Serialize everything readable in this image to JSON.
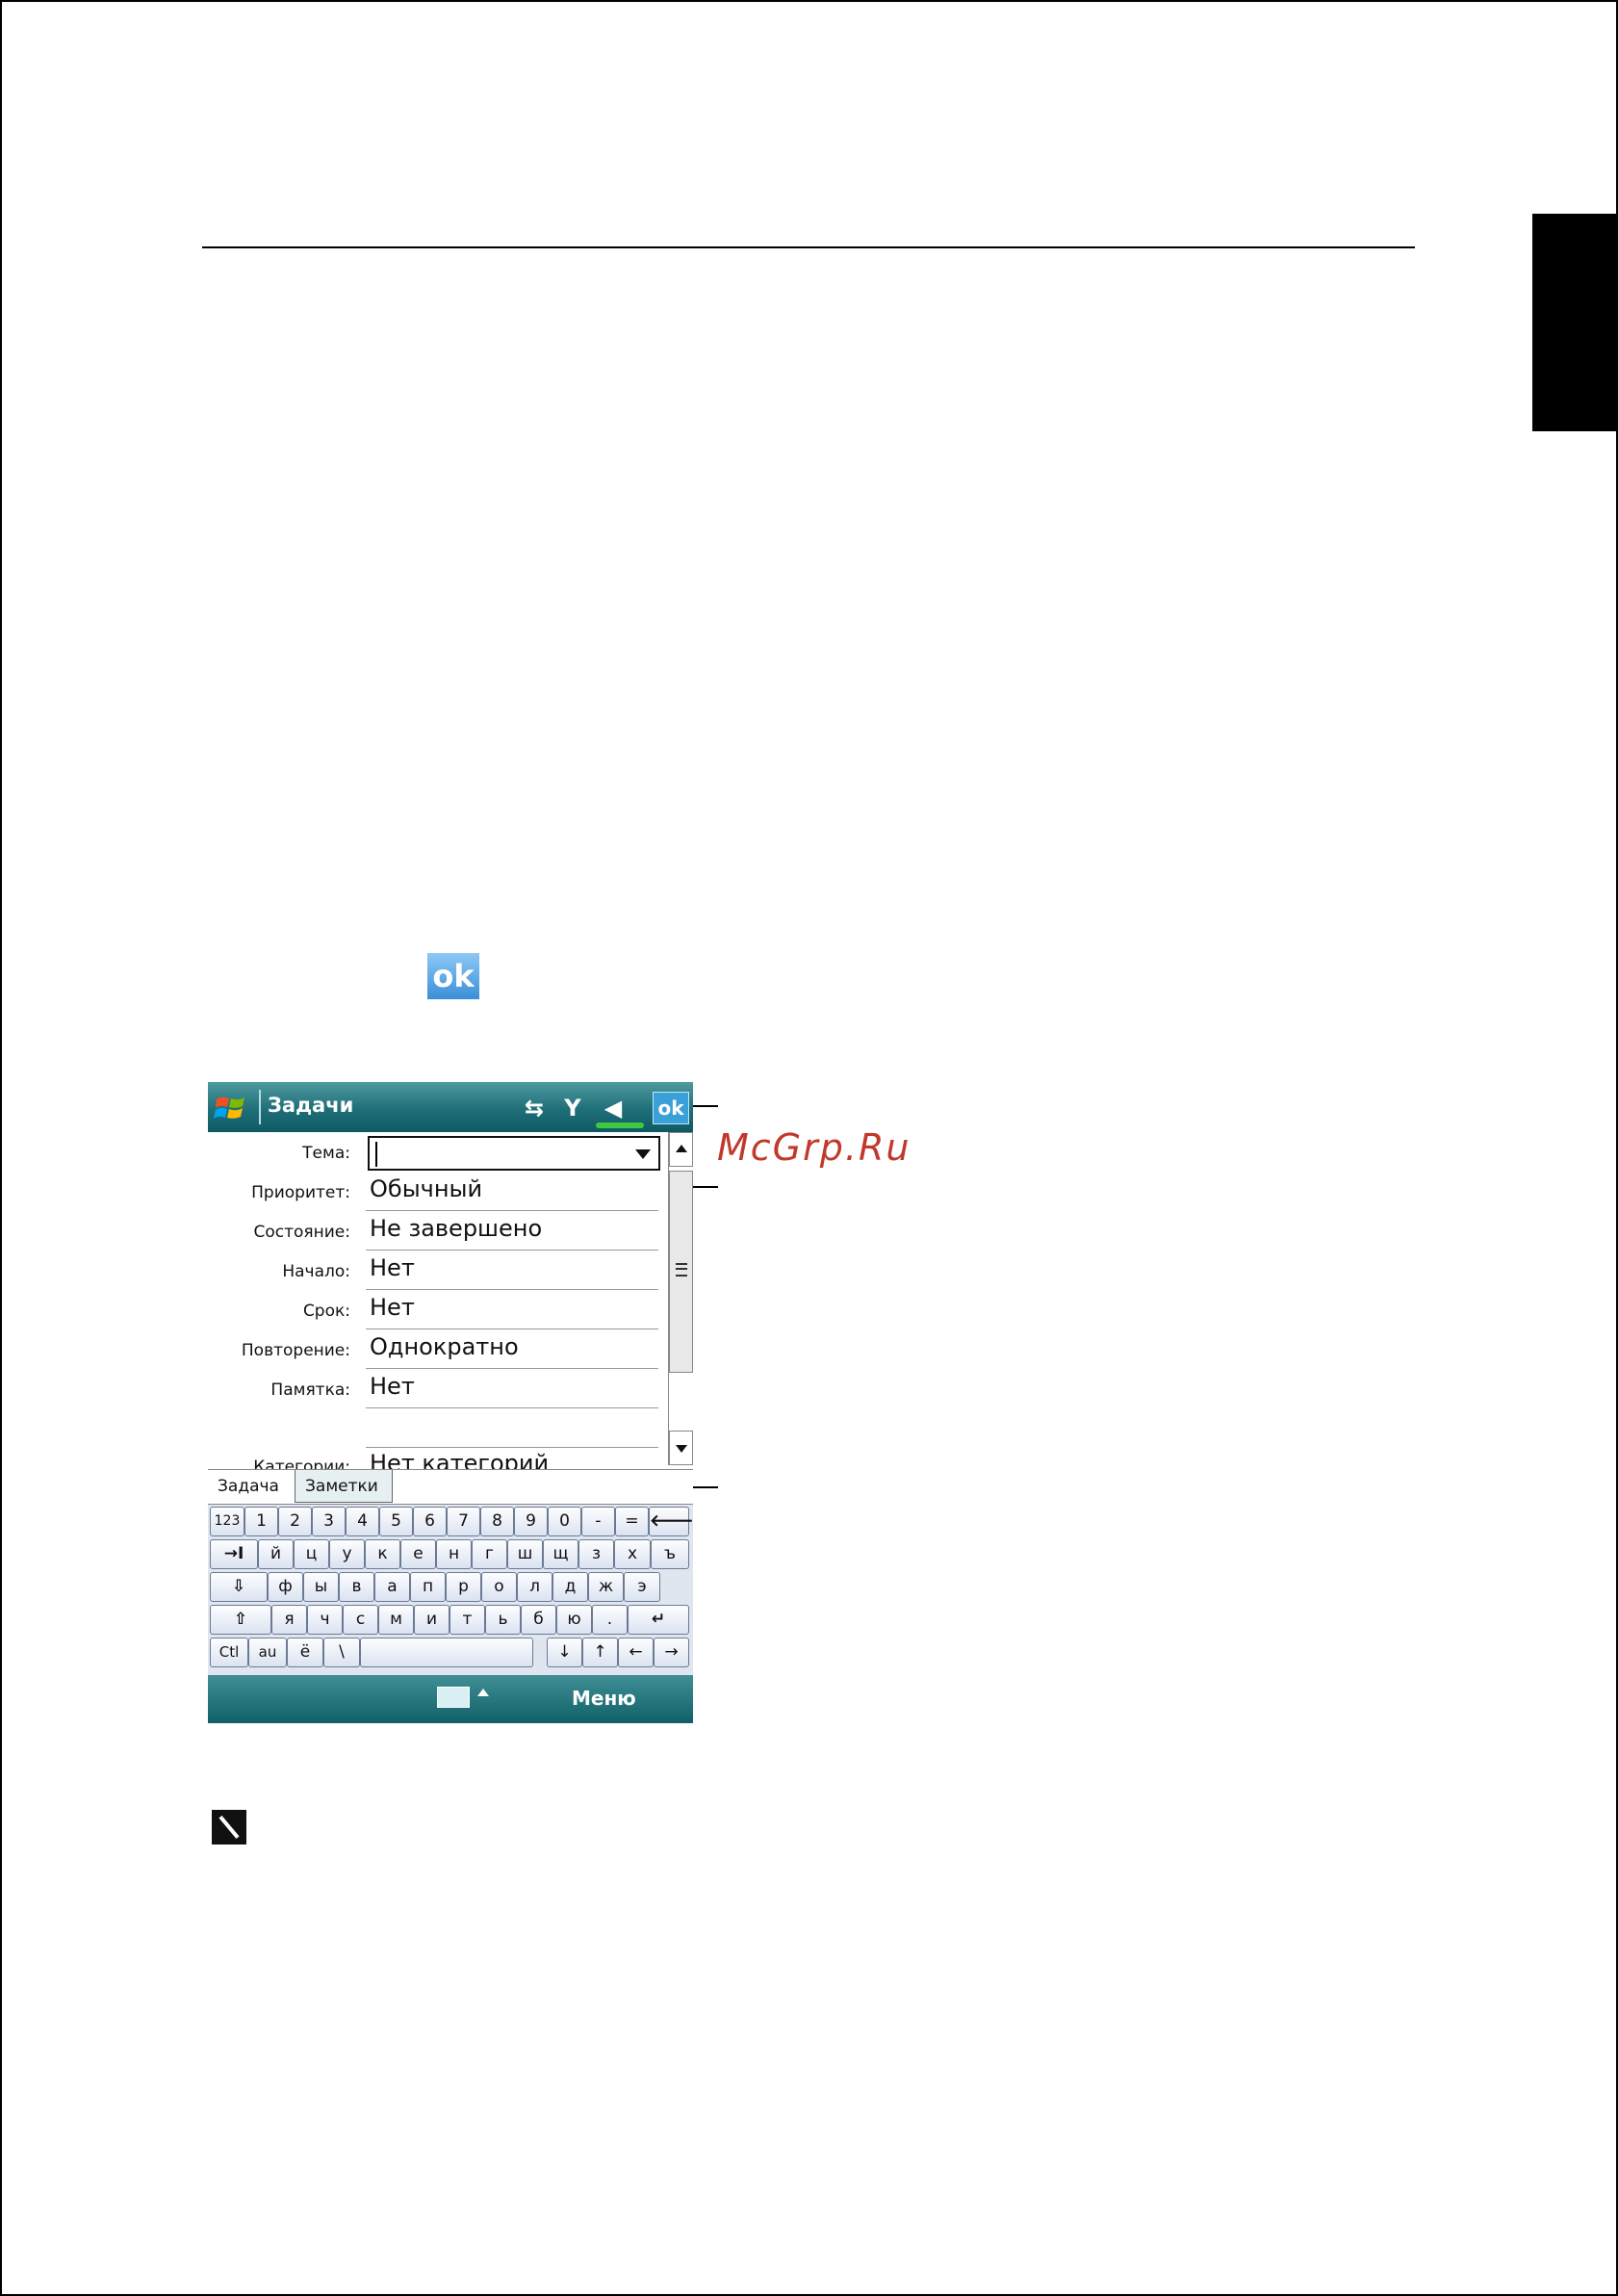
{
  "page": {
    "ok_icon_label": "ok",
    "watermark": "McGrp.Ru"
  },
  "device": {
    "titlebar": {
      "title": "Задачи",
      "ok_label": "ok"
    },
    "form": {
      "fields": [
        {
          "label": "Тема:",
          "value": ""
        },
        {
          "label": "Приоритет:",
          "value": "Обычный"
        },
        {
          "label": "Состояние:",
          "value": "Не завершено"
        },
        {
          "label": "Начало:",
          "value": "Нет"
        },
        {
          "label": "Срок:",
          "value": "Нет"
        },
        {
          "label": "Повторение:",
          "value": "Однократно"
        },
        {
          "label": "Памятка:",
          "value": "Нет"
        },
        {
          "label": "",
          "value": ""
        },
        {
          "label": "Категории:",
          "value": "Нет категорий"
        }
      ]
    },
    "tabs": [
      {
        "label": "Задача"
      },
      {
        "label": "Заметки"
      }
    ],
    "keyboard": {
      "rows": [
        [
          "123",
          "1",
          "2",
          "3",
          "4",
          "5",
          "6",
          "7",
          "8",
          "9",
          "0",
          "-",
          "=",
          "🡐"
        ],
        [
          "→I",
          "й",
          "ц",
          "у",
          "к",
          "е",
          "н",
          "г",
          "ш",
          "щ",
          "з",
          "х",
          "ъ"
        ],
        [
          "⇩",
          "ф",
          "ы",
          "в",
          "а",
          "п",
          "р",
          "о",
          "л",
          "д",
          "ж",
          "э"
        ],
        [
          "⇧",
          "я",
          "ч",
          "с",
          "м",
          "и",
          "т",
          "ь",
          "б",
          "ю",
          ".",
          "↵"
        ],
        [
          "Ctl",
          "au",
          "ё",
          "\\",
          "",
          "↓",
          "↑",
          "←",
          "→"
        ]
      ]
    },
    "bottombar": {
      "menu_label": "Меню"
    }
  }
}
